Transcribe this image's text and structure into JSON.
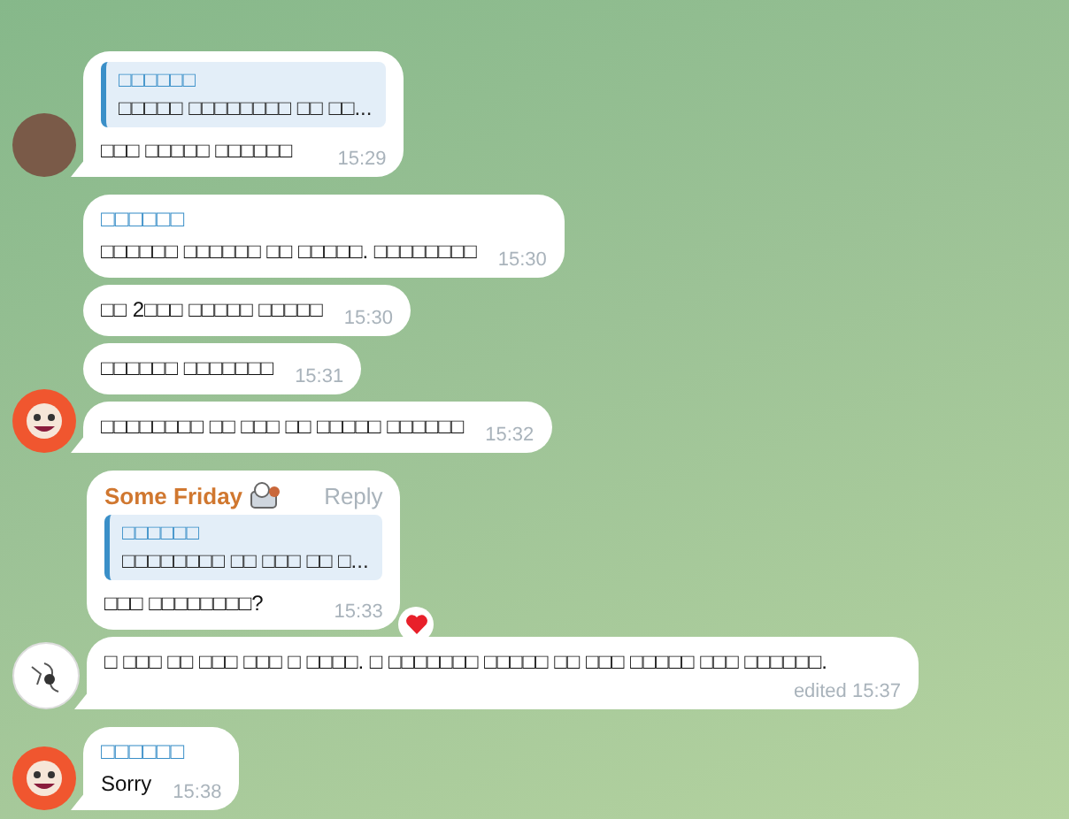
{
  "groups": [
    {
      "avatar": {
        "kind": "photo"
      },
      "messages": [
        {
          "quote": {
            "name": "□□□□□□",
            "text": "□□□□□ □□□□□□□□ □□ □□..."
          },
          "text": "□□□ □□□□□ □□□□□□",
          "time": "15:29"
        }
      ]
    },
    {
      "avatar": {
        "kind": "clown"
      },
      "messages": [
        {
          "sender": {
            "name": "□□□□□□",
            "color": "#3a8fc8"
          },
          "text": "□□□□□□ □□□□□□ □□ □□□□□. □□□□□□□□",
          "time": "15:30"
        },
        {
          "text": "□□ 2□□□ □□□□□ □□□□□",
          "time": "15:30"
        },
        {
          "text": "□□□□□□ □□□□□□□",
          "time": "15:31"
        },
        {
          "text": "□□□□□□□□ □□ □□□ □□ □□□□□ □□□□□□",
          "time": "15:32"
        }
      ]
    },
    {
      "avatar": {
        "kind": "sketch"
      },
      "messages": [
        {
          "sender": {
            "name": "Some Friday",
            "color": "#d0772f",
            "sticker": true
          },
          "action": "Reply",
          "quote": {
            "name": "□□□□□□",
            "text": "□□□□□□□□ □□ □□□ □□ □..."
          },
          "text": "□□□ □□□□□□□□?",
          "time": "15:33",
          "reaction": {
            "kind": "heart"
          }
        },
        {
          "text": "□ □□□ □□ □□□ □□□ □ □□□□. □ □□□□□□□ □□□□□ □□ □□□ □□□□□ □□□ □□□□□□.",
          "status": "edited",
          "time": "15:37"
        }
      ]
    },
    {
      "avatar": {
        "kind": "clown"
      },
      "messages": [
        {
          "sender": {
            "name": "□□□□□□",
            "color": "#3a8fc8"
          },
          "text": "Sorry",
          "time": "15:38"
        }
      ]
    }
  ]
}
